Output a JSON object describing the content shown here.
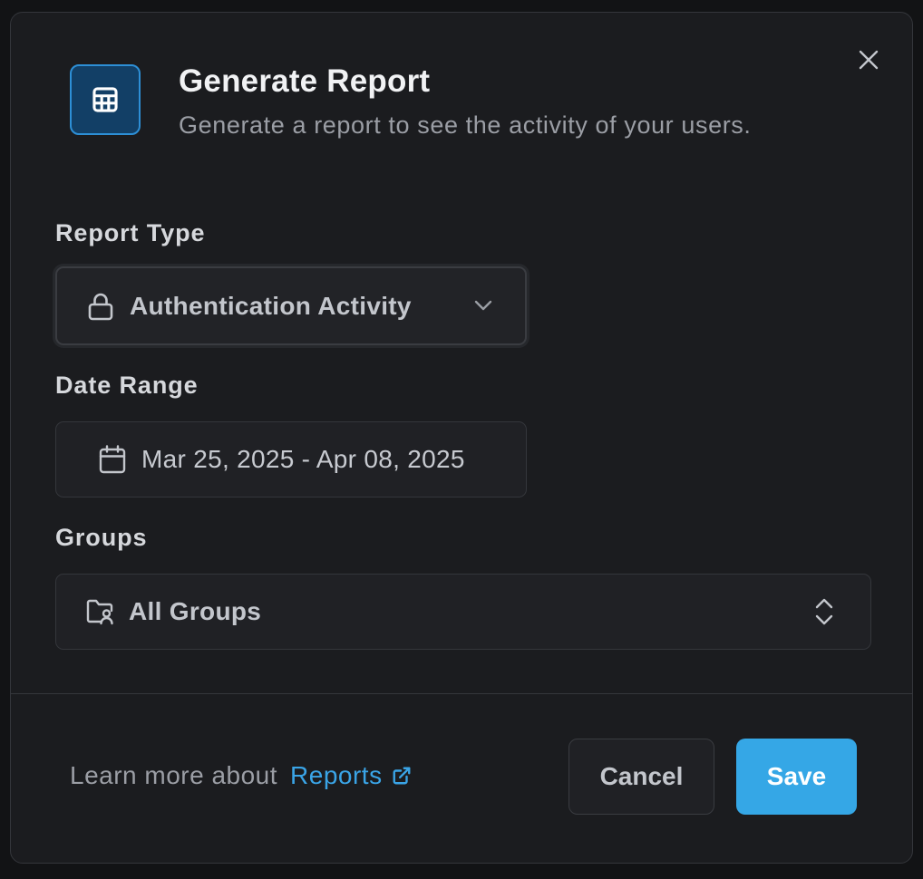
{
  "dialog": {
    "title": "Generate Report",
    "subtitle": "Generate a report to see the activity of your users.",
    "header_icon": "table-icon",
    "close_icon": "close-icon"
  },
  "report_type": {
    "label": "Report Type",
    "value": "Authentication Activity",
    "icon": "lock-icon",
    "control_icon": "chevron-down-icon"
  },
  "date_range": {
    "label": "Date Range",
    "value": "Mar 25, 2025 - Apr 08, 2025",
    "icon": "calendar-icon"
  },
  "groups": {
    "label": "Groups",
    "value": "All Groups",
    "icon": "folder-user-icon",
    "control_icon": "chevron-up-down-icon"
  },
  "footer": {
    "learn_text": "Learn more about",
    "link_text": "Reports",
    "link_icon": "external-link-icon",
    "cancel_label": "Cancel",
    "save_label": "Save"
  },
  "colors": {
    "accent": "#35a7e6",
    "link": "#3aa4e6",
    "background": "#1b1c1f"
  }
}
